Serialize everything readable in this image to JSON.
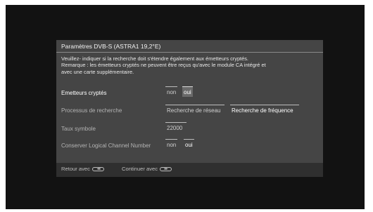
{
  "dialog": {
    "title": "Paramètres DVB-S (ASTRA1 19,2°E)",
    "description_lines": [
      "Veuillez- indiquer si la recherche doit s'étendre également  aux émetteurs cryptés.",
      "Remarque : les émetteurs cryptés ne peuvent être reçus qu'avec le module CA intégré et",
      "avec une carte supplémentaire."
    ]
  },
  "rows": [
    {
      "label": "Emetteurs cryptés",
      "options": [
        "non",
        "oui"
      ],
      "selected": "oui"
    },
    {
      "label": "Processus de recherche",
      "options": [
        "Recherche de réseau",
        "Recherche de fréquence"
      ],
      "selected": "Recherche de fréquence"
    },
    {
      "label": "Taux symbole",
      "value": "22000"
    },
    {
      "label": "Conserver Logical Channel Number",
      "options": [
        "non",
        "oui"
      ],
      "selected": "oui"
    }
  ],
  "footer": {
    "back_label": "Retour avec",
    "back_icon": "rewind-button-icon",
    "continue_label": "Continuer avec",
    "continue_icon": "fast-forward-button-icon"
  },
  "colors": {
    "background": "#121212",
    "dialog": "#454545",
    "highlight": "#6a6a6a",
    "footer": "#2f2f2f"
  }
}
